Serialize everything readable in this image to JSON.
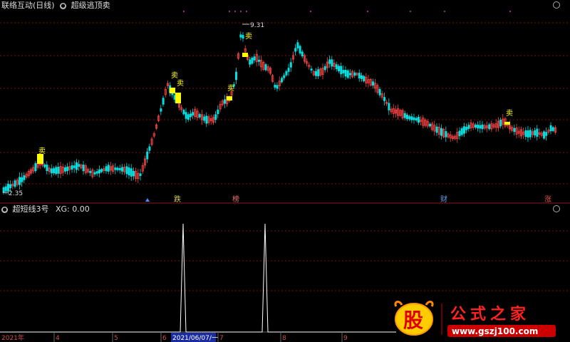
{
  "top_panel": {
    "stock_title": "联络互动(日线)",
    "indicator_title": "超级逃顶卖",
    "high_label": "9.31",
    "low_label": "2.35",
    "sell_label": "卖",
    "markers": [
      {
        "label": "跌",
        "color": "#d0d050"
      },
      {
        "label": "榜",
        "color": "#e07070"
      },
      {
        "label": "财",
        "color": "#60a0e0"
      },
      {
        "label": "涨",
        "color": "#e05050"
      }
    ]
  },
  "bottom_panel": {
    "indicator_name": "超短线3号",
    "xg_label": "XG:",
    "xg_value": "0.00"
  },
  "time_axis": {
    "labels": [
      "2021年",
      "4",
      "5",
      "6",
      "2021/06/07/一",
      "7",
      "8",
      "9"
    ]
  },
  "watermark": {
    "logo_char": "股",
    "title": "公式之家",
    "url": "www.gszj100.com"
  },
  "colors": {
    "up": "#ff4444",
    "down": "#00e0e0",
    "sell_box": "#ffff00",
    "signal_line": "#ffffff",
    "grid": "#7a1010"
  },
  "chart_data": {
    "type": "candlestick",
    "price_range": [
      2.35,
      9.31
    ],
    "sell_signal_count": 6,
    "xg_spikes": 2,
    "xg_spike_value": 1,
    "xg_baseline": 0
  }
}
